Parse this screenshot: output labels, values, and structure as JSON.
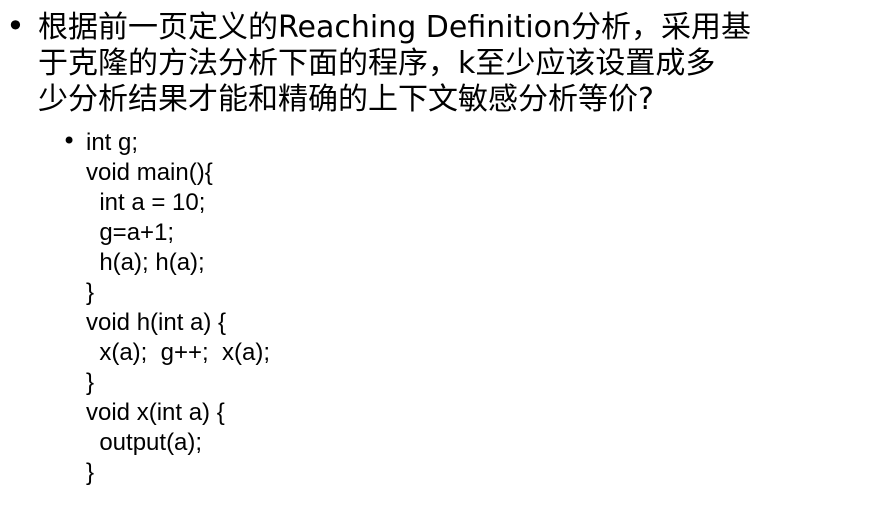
{
  "question": {
    "lines": [
      "根据前一页定义的Reaching Definition分析，采用基",
      "于克隆的方法分析下面的程序，k至少应该设置成多",
      "少分析结果才能和精确的上下文敏感分析等价?"
    ]
  },
  "code": {
    "lines": [
      "int g;",
      "void main(){",
      "  int a = 10;",
      "  g=a+1;",
      "  h(a); h(a);",
      "}",
      "void h(int a) {",
      "  x(a);  g++;  x(a);",
      "}",
      "void x(int a) {",
      "  output(a);",
      "}"
    ]
  }
}
